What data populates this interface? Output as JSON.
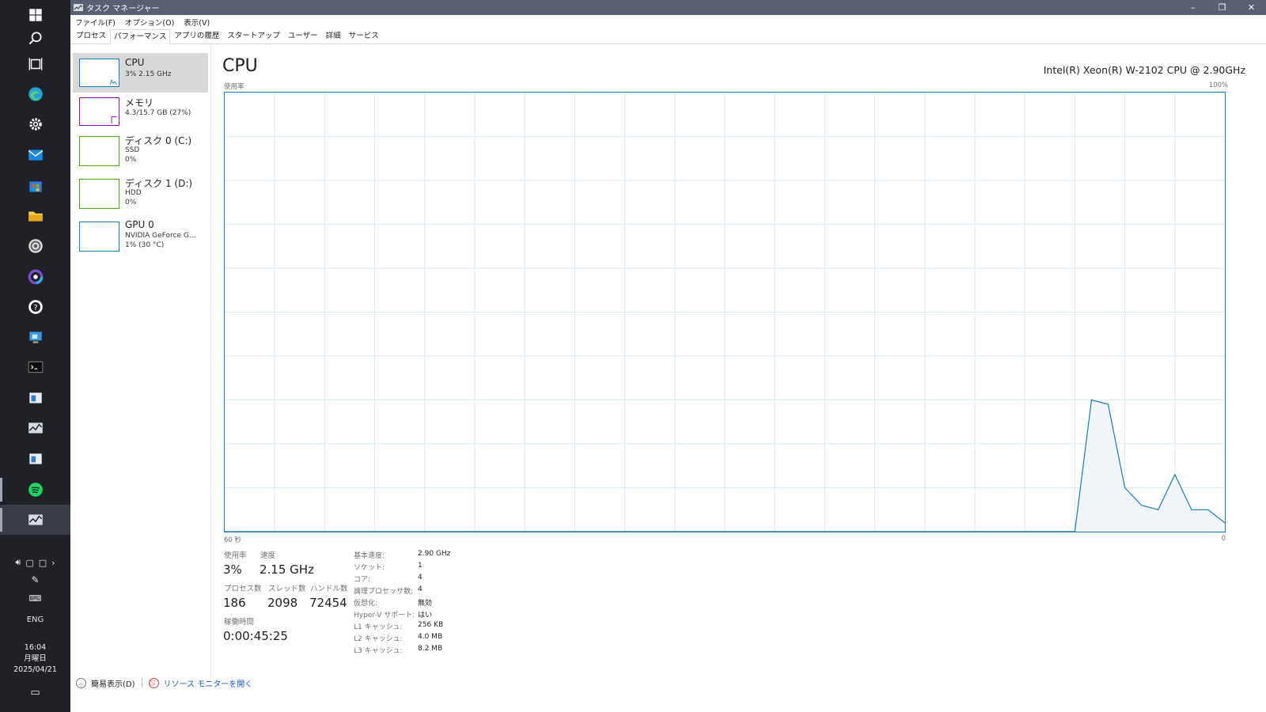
{
  "taskbar": {
    "icons": [
      "windows-start-icon",
      "search-icon",
      "task-view-icon",
      "edge-icon",
      "settings-gear-icon",
      "mail-icon",
      "store-icon",
      "file-explorer-icon",
      "app-swirl-icon",
      "colorful-ring-icon",
      "chat-icon",
      "rdp-icon",
      "terminal-icon",
      "window-icon",
      "task-manager-icon",
      "window2-icon",
      "spotify-icon",
      "task-manager-active-icon"
    ],
    "language": "ENG",
    "time": "16:04",
    "weekday": "月曜日",
    "date": "2025/04/21"
  },
  "window": {
    "title": "タスク マネージャー",
    "menu": [
      "ファイル(F)",
      "オプション(O)",
      "表示(V)"
    ],
    "tabs": [
      "プロセス",
      "パフォーマンス",
      "アプリの履歴",
      "スタートアップ",
      "ユーザー",
      "詳細",
      "サービス"
    ],
    "selected_tab": "パフォーマンス"
  },
  "sidebar": {
    "items": [
      {
        "name": "CPU",
        "sub1": "3%  2.15 GHz",
        "sub2": "",
        "color": "#117dbb"
      },
      {
        "name": "メモリ",
        "sub1": "4.3/15.7 GB (27%)",
        "sub2": "",
        "color": "#8b12ae"
      },
      {
        "name": "ディスク 0 (C:)",
        "sub1": "SSD",
        "sub2": "0%",
        "color": "#4da60c"
      },
      {
        "name": "ディスク 1 (D:)",
        "sub1": "HDD",
        "sub2": "0%",
        "color": "#4da60c"
      },
      {
        "name": "GPU 0",
        "sub1": "NVIDIA GeForce G...",
        "sub2": "1%  (30 °C)",
        "color": "#117dbb"
      }
    ]
  },
  "main": {
    "title": "CPU",
    "model": "Intel(R) Xeon(R) W-2102 CPU @ 2.90GHz",
    "graph_label": "使用率",
    "graph_max": "100%",
    "graph_time": "60 秒",
    "graph_min": "0"
  },
  "chart_data": {
    "type": "area",
    "x": [
      60,
      57,
      54,
      51,
      48,
      45,
      42,
      39,
      36,
      33,
      30,
      27,
      24,
      21,
      18,
      15,
      12,
      9,
      8,
      7,
      6,
      5,
      4,
      3,
      2,
      1,
      0
    ],
    "series": [
      {
        "values": [
          0,
          0,
          0,
          0,
          0,
          0,
          0,
          0,
          0,
          0,
          0,
          0,
          0,
          0,
          0,
          0,
          0,
          0,
          30,
          29,
          10,
          6,
          5,
          13,
          5,
          5,
          2
        ]
      }
    ],
    "ylim": [
      0,
      100
    ],
    "xlim": [
      60,
      0
    ],
    "grid": true,
    "color": "#117dbb",
    "fill": "#f1f6fa"
  },
  "stats": {
    "usage_label": "使用率",
    "usage": "3%",
    "speed_label": "速度",
    "speed": "2.15 GHz",
    "processes_label": "プロセス数",
    "processes": "186",
    "threads_label": "スレッド数",
    "threads": "2098",
    "handles_label": "ハンドル数",
    "handles": "72454",
    "uptime_label": "稼働時間",
    "uptime": "0:00:45:25"
  },
  "details": [
    {
      "label": "基本速度:",
      "value": "2.90 GHz"
    },
    {
      "label": "ソケット:",
      "value": "1"
    },
    {
      "label": "コア:",
      "value": "4"
    },
    {
      "label": "論理プロセッサ数:",
      "value": "4"
    },
    {
      "label": "仮想化:",
      "value": "無効"
    },
    {
      "label": "Hyper-V サポート:",
      "value": "はい"
    },
    {
      "label": "L1 キャッシュ:",
      "value": "256 KB"
    },
    {
      "label": "L2 キャッシュ:",
      "value": "4.0 MB"
    },
    {
      "label": "L3 キャッシュ:",
      "value": "8.2 MB"
    }
  ],
  "footer": {
    "simple_view": "簡易表示(D)",
    "resource_monitor": "リソース モニターを開く"
  }
}
